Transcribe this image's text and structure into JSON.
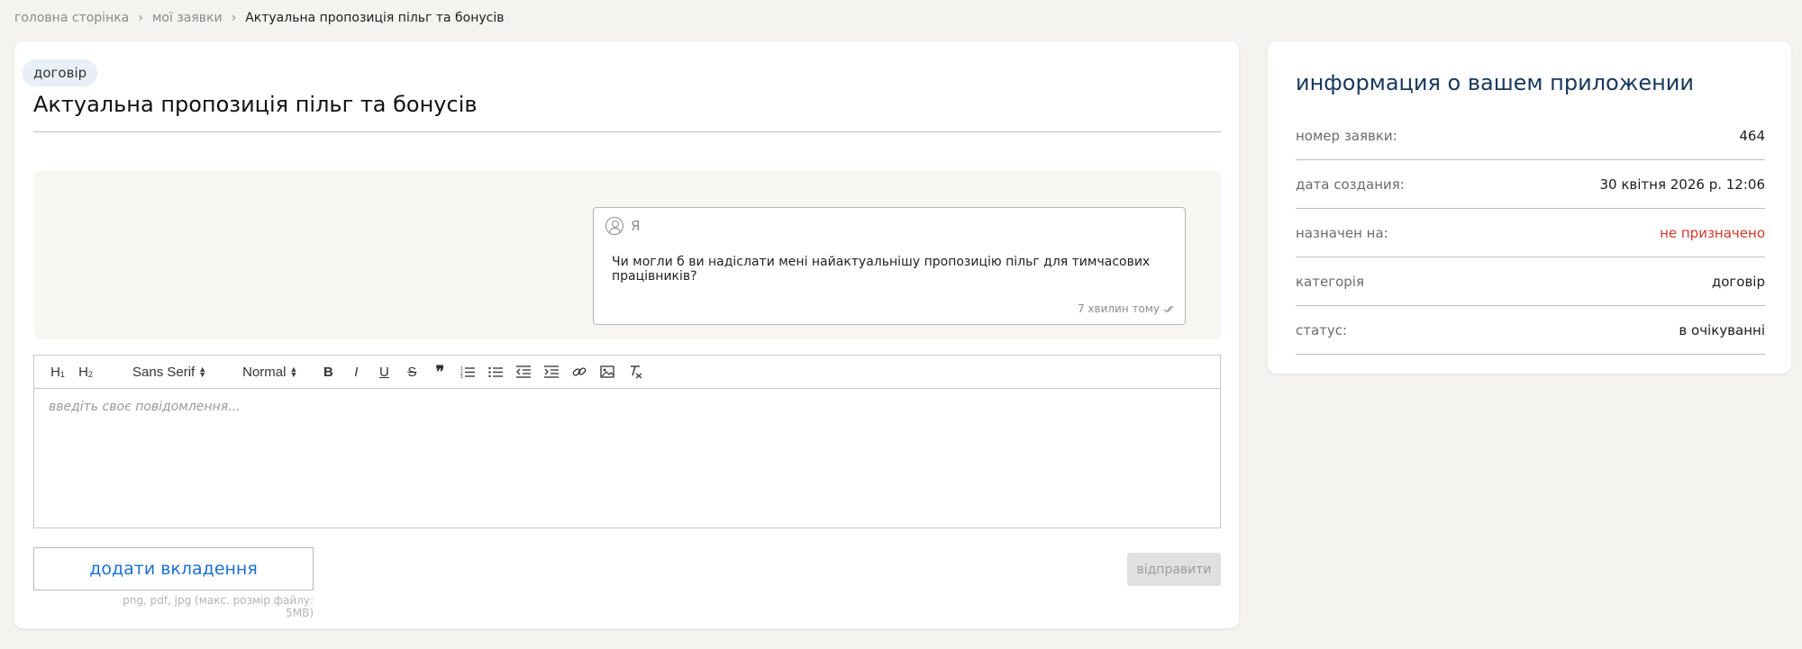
{
  "breadcrumb": {
    "home": "головна сторінка",
    "my_requests": "мої заявки",
    "current": "Актуальна пропозиція пільг та бонусів",
    "separator": "›"
  },
  "ticket": {
    "tag": "договір",
    "title": "Актуальна пропозиція пільг та бонусів"
  },
  "messages": [
    {
      "author": "Я",
      "text": "Чи могли б ви надіслати мені найактуальнішу пропозицію пільг для тимчасових працівників?",
      "time": "7 хвилин тому"
    }
  ],
  "editor": {
    "toolbar": {
      "h1": "H",
      "h1_sub": "1",
      "h2": "H",
      "h2_sub": "2",
      "font": "Sans Serif",
      "size": "Normal",
      "bold": "B",
      "italic": "I",
      "underline": "U",
      "strike": "S",
      "quote": "❞"
    },
    "placeholder": "введіть своє повідомлення..."
  },
  "attach": {
    "label": "додати вкладення",
    "hint": "png, pdf, jpg (макс. розмір файлу: 5MB)"
  },
  "send": {
    "label": "відправити"
  },
  "info": {
    "title": "информация о вашем приложении",
    "rows": [
      {
        "label": "номер заявки:",
        "value": "464"
      },
      {
        "label": "дата создания:",
        "value": "30 квітня 2026 р. 12:06"
      },
      {
        "label": "назначен на:",
        "value": "не призначено"
      },
      {
        "label": "категорія",
        "value": "договір"
      },
      {
        "label": "статус:",
        "value": "в очікуванні"
      }
    ]
  },
  "colors": {
    "accent_blue": "#1e6fd0",
    "title_navy": "#17375e",
    "unassigned_red": "#d23a2b",
    "page_bg": "#f4f3ef"
  }
}
